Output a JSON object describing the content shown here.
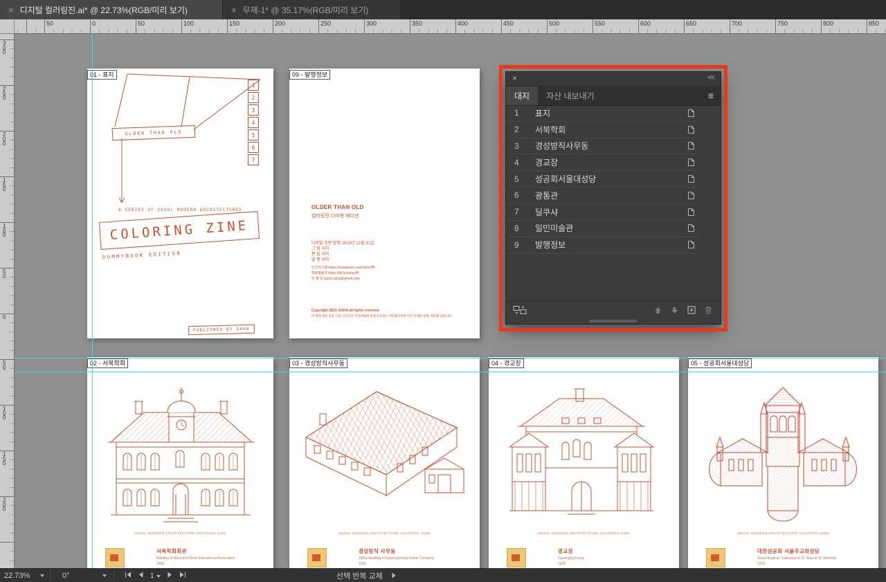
{
  "window": {
    "tabs": [
      {
        "label": "디지털 컬러링진.ai* @ 22.73%(RGB/미리 보기)",
        "active": true
      },
      {
        "label": "무제-1* @ 35.17%(RGB/미리 보기)",
        "active": false
      }
    ]
  },
  "icons": {
    "close": "×",
    "collapse": "<<",
    "menu": "≡"
  },
  "colors": {
    "accent": "#c8502d",
    "annotation_red": "#e8391d",
    "guide_cyan": "#35e2e8",
    "canvas_gray": "#8f8f8f"
  },
  "rulers": {
    "horizontal": [
      "50",
      "0",
      "50",
      "100",
      "150",
      "200",
      "250",
      "300",
      "350",
      "400",
      "450",
      "500",
      "550",
      "600",
      "650",
      "700",
      "750",
      "800",
      "850"
    ],
    "vertical": [
      "300",
      "250",
      "200",
      "150",
      "100",
      "50",
      "0",
      "50",
      "100",
      "150",
      "200"
    ]
  },
  "artboards": {
    "cover": {
      "label": "01 - 표지",
      "page_numbers": [
        "1",
        "2",
        "3",
        "4",
        "5",
        "6",
        "7"
      ],
      "ribbon": "OLDER THAN OLD",
      "series": "A SERIES OF SEOUL MODERN ARCHITECTURES",
      "title": "COLORING ZINE",
      "edition": "DUMMYBOOK EDITION",
      "publisher": "PUBLISHED BY SAHA"
    },
    "info": {
      "label": "09 - 발행정보",
      "title": "OLDER THAN OLD",
      "subtitle": "컬러링진 더미북 에디션",
      "issue": "디지털 초판 발행    2023년 12월 31일",
      "credits": [
        "그    림    사하",
        "편    집    사하",
        "발    행    사하"
      ],
      "contacts": [
        "인스타그램    https://instagram.com/saha.ffff",
        "프로필링크    https://litt.ly/saha.ffff",
        "이 메 일    jashit.saha@gmail.com"
      ],
      "copyright": "Copyright 2023. SAHA all rights reserved.",
      "notice": "이 책에 실린 글과 그림, 디자인은 저작권법에 의해 보호받는 저작물이므로 무단 전재와 복제, 배포를 금합니다."
    },
    "b02": {
      "label": "02 - 서북학회",
      "caption": "SEOUL MODERN ARCHITECTURE COLORING ZINE",
      "strip": {
        "title": "서북학회회관",
        "lines": [
          "Building of West and North Educational Association",
          "1908"
        ]
      }
    },
    "b03": {
      "label": "03 - 경성방직사무동",
      "caption": "SEOUL MODERN ARCHITECTURE COLORING ZINE",
      "strip": {
        "title": "경성방직 사무동",
        "lines": [
          "Office Building of GyeongSeong Textile Company",
          "1936"
        ]
      }
    },
    "b04": {
      "label": "04 - 경교장",
      "caption": "SEOUL MODERN ARCHITECTURE COLORING ZINE",
      "strip": {
        "title": "경교장",
        "lines": [
          "GyeongGyoJang",
          "1938"
        ]
      }
    },
    "b05": {
      "label": "05 - 성공회서울대성당",
      "caption": "SEOUL MODERN ARCHITECTURE COLORING ZINE",
      "strip": {
        "title": "대한성공회 서울주교좌성당",
        "lines": [
          "Seoul Anglican Cathedral of St. Mary & St. Nicholas",
          "1926"
        ]
      }
    }
  },
  "panel": {
    "tabs": [
      {
        "label": "대지",
        "active": true
      },
      {
        "label": "자산 내보내기",
        "active": false
      }
    ],
    "items": [
      {
        "num": "1",
        "name": "표지"
      },
      {
        "num": "2",
        "name": "서북학회"
      },
      {
        "num": "3",
        "name": "경성방직사무동"
      },
      {
        "num": "4",
        "name": "경교장"
      },
      {
        "num": "5",
        "name": "성공회서울대성당"
      },
      {
        "num": "6",
        "name": "광통관"
      },
      {
        "num": "7",
        "name": "딜쿠샤"
      },
      {
        "num": "8",
        "name": "일민미술관"
      },
      {
        "num": "9",
        "name": "발행정보"
      }
    ]
  },
  "statusbar": {
    "zoom": "22.73%",
    "rotation": "0°",
    "artboard": "1",
    "status": "선택 반복 교체"
  }
}
